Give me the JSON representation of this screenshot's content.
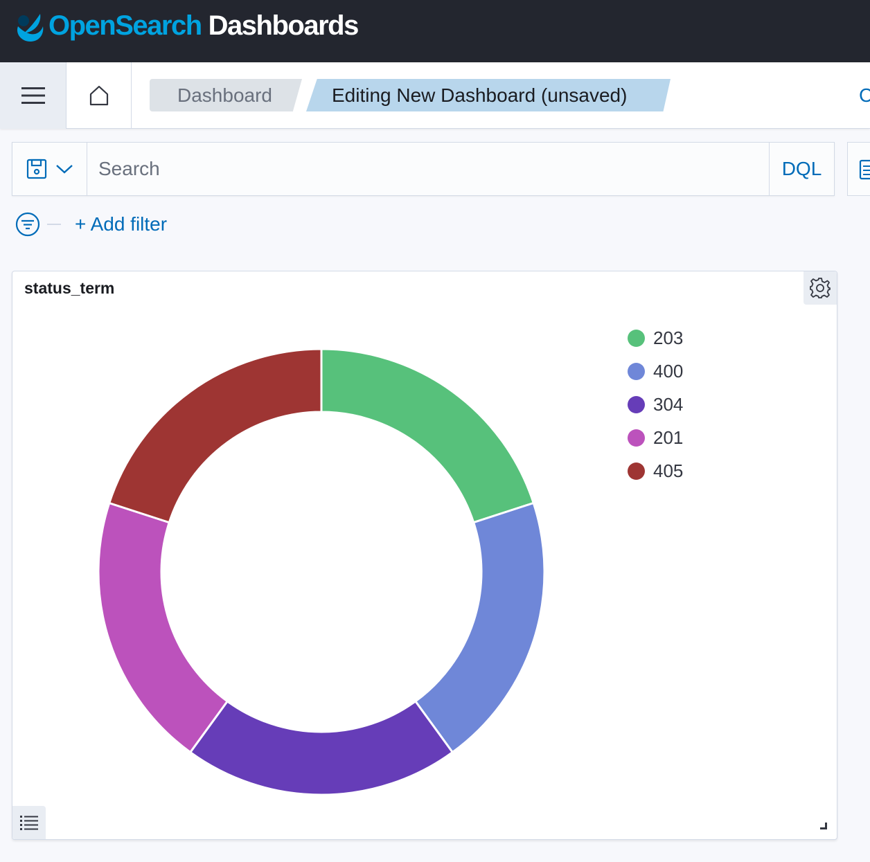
{
  "header": {
    "brand_part1": "OpenSearch",
    "brand_part2": "Dashboards"
  },
  "nav": {
    "breadcrumbs": [
      "Dashboard",
      "Editing New Dashboard (unsaved)"
    ],
    "right_link_partial": "C"
  },
  "query": {
    "placeholder": "Search",
    "language": "DQL"
  },
  "filters": {
    "add_label": "+ Add filter"
  },
  "panel": {
    "title": "status_term"
  },
  "chart_data": {
    "type": "pie",
    "donut": true,
    "categories": [
      "203",
      "400",
      "304",
      "201",
      "405"
    ],
    "values": [
      20,
      20,
      20,
      20,
      20
    ],
    "colors": [
      "#57c17b",
      "#6f87d8",
      "#663db8",
      "#bc52bc",
      "#9e3533"
    ],
    "legend_position": "right"
  },
  "colors": {
    "header_bg": "#23262f",
    "brand_blue": "#00a3e0",
    "link_blue": "#006bb8"
  }
}
